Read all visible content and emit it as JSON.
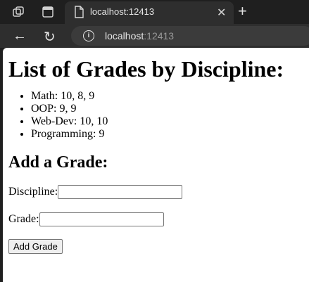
{
  "browser": {
    "tab_title": "localhost:12413",
    "close_glyph": "✕",
    "new_tab_glyph": "+",
    "back_glyph": "←",
    "reload_glyph": "↻",
    "info_glyph": "i",
    "url_host": "localhost",
    "url_port": ":12413"
  },
  "page": {
    "title": "List of Grades by Discipline:",
    "grades": [
      "Math: 10, 8, 9",
      "OOP: 9, 9",
      "Web-Dev: 10, 10",
      "Programming: 9"
    ],
    "form": {
      "heading": "Add a Grade:",
      "discipline_label": "Discipline:",
      "discipline_value": "",
      "grade_label": "Grade:",
      "grade_value": "",
      "submit_label": "Add Grade"
    }
  }
}
